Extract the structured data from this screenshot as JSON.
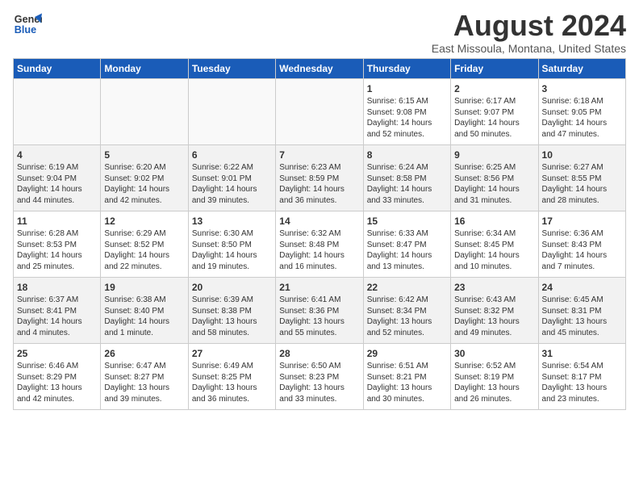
{
  "header": {
    "logo_line1": "General",
    "logo_line2": "Blue",
    "month": "August 2024",
    "location": "East Missoula, Montana, United States"
  },
  "weekdays": [
    "Sunday",
    "Monday",
    "Tuesday",
    "Wednesday",
    "Thursday",
    "Friday",
    "Saturday"
  ],
  "weeks": [
    [
      {
        "day": "",
        "info": ""
      },
      {
        "day": "",
        "info": ""
      },
      {
        "day": "",
        "info": ""
      },
      {
        "day": "",
        "info": ""
      },
      {
        "day": "1",
        "info": "Sunrise: 6:15 AM\nSunset: 9:08 PM\nDaylight: 14 hours\nand 52 minutes."
      },
      {
        "day": "2",
        "info": "Sunrise: 6:17 AM\nSunset: 9:07 PM\nDaylight: 14 hours\nand 50 minutes."
      },
      {
        "day": "3",
        "info": "Sunrise: 6:18 AM\nSunset: 9:05 PM\nDaylight: 14 hours\nand 47 minutes."
      }
    ],
    [
      {
        "day": "4",
        "info": "Sunrise: 6:19 AM\nSunset: 9:04 PM\nDaylight: 14 hours\nand 44 minutes."
      },
      {
        "day": "5",
        "info": "Sunrise: 6:20 AM\nSunset: 9:02 PM\nDaylight: 14 hours\nand 42 minutes."
      },
      {
        "day": "6",
        "info": "Sunrise: 6:22 AM\nSunset: 9:01 PM\nDaylight: 14 hours\nand 39 minutes."
      },
      {
        "day": "7",
        "info": "Sunrise: 6:23 AM\nSunset: 8:59 PM\nDaylight: 14 hours\nand 36 minutes."
      },
      {
        "day": "8",
        "info": "Sunrise: 6:24 AM\nSunset: 8:58 PM\nDaylight: 14 hours\nand 33 minutes."
      },
      {
        "day": "9",
        "info": "Sunrise: 6:25 AM\nSunset: 8:56 PM\nDaylight: 14 hours\nand 31 minutes."
      },
      {
        "day": "10",
        "info": "Sunrise: 6:27 AM\nSunset: 8:55 PM\nDaylight: 14 hours\nand 28 minutes."
      }
    ],
    [
      {
        "day": "11",
        "info": "Sunrise: 6:28 AM\nSunset: 8:53 PM\nDaylight: 14 hours\nand 25 minutes."
      },
      {
        "day": "12",
        "info": "Sunrise: 6:29 AM\nSunset: 8:52 PM\nDaylight: 14 hours\nand 22 minutes."
      },
      {
        "day": "13",
        "info": "Sunrise: 6:30 AM\nSunset: 8:50 PM\nDaylight: 14 hours\nand 19 minutes."
      },
      {
        "day": "14",
        "info": "Sunrise: 6:32 AM\nSunset: 8:48 PM\nDaylight: 14 hours\nand 16 minutes."
      },
      {
        "day": "15",
        "info": "Sunrise: 6:33 AM\nSunset: 8:47 PM\nDaylight: 14 hours\nand 13 minutes."
      },
      {
        "day": "16",
        "info": "Sunrise: 6:34 AM\nSunset: 8:45 PM\nDaylight: 14 hours\nand 10 minutes."
      },
      {
        "day": "17",
        "info": "Sunrise: 6:36 AM\nSunset: 8:43 PM\nDaylight: 14 hours\nand 7 minutes."
      }
    ],
    [
      {
        "day": "18",
        "info": "Sunrise: 6:37 AM\nSunset: 8:41 PM\nDaylight: 14 hours\nand 4 minutes."
      },
      {
        "day": "19",
        "info": "Sunrise: 6:38 AM\nSunset: 8:40 PM\nDaylight: 14 hours\nand 1 minute."
      },
      {
        "day": "20",
        "info": "Sunrise: 6:39 AM\nSunset: 8:38 PM\nDaylight: 13 hours\nand 58 minutes."
      },
      {
        "day": "21",
        "info": "Sunrise: 6:41 AM\nSunset: 8:36 PM\nDaylight: 13 hours\nand 55 minutes."
      },
      {
        "day": "22",
        "info": "Sunrise: 6:42 AM\nSunset: 8:34 PM\nDaylight: 13 hours\nand 52 minutes."
      },
      {
        "day": "23",
        "info": "Sunrise: 6:43 AM\nSunset: 8:32 PM\nDaylight: 13 hours\nand 49 minutes."
      },
      {
        "day": "24",
        "info": "Sunrise: 6:45 AM\nSunset: 8:31 PM\nDaylight: 13 hours\nand 45 minutes."
      }
    ],
    [
      {
        "day": "25",
        "info": "Sunrise: 6:46 AM\nSunset: 8:29 PM\nDaylight: 13 hours\nand 42 minutes."
      },
      {
        "day": "26",
        "info": "Sunrise: 6:47 AM\nSunset: 8:27 PM\nDaylight: 13 hours\nand 39 minutes."
      },
      {
        "day": "27",
        "info": "Sunrise: 6:49 AM\nSunset: 8:25 PM\nDaylight: 13 hours\nand 36 minutes."
      },
      {
        "day": "28",
        "info": "Sunrise: 6:50 AM\nSunset: 8:23 PM\nDaylight: 13 hours\nand 33 minutes."
      },
      {
        "day": "29",
        "info": "Sunrise: 6:51 AM\nSunset: 8:21 PM\nDaylight: 13 hours\nand 30 minutes."
      },
      {
        "day": "30",
        "info": "Sunrise: 6:52 AM\nSunset: 8:19 PM\nDaylight: 13 hours\nand 26 minutes."
      },
      {
        "day": "31",
        "info": "Sunrise: 6:54 AM\nSunset: 8:17 PM\nDaylight: 13 hours\nand 23 minutes."
      }
    ]
  ]
}
